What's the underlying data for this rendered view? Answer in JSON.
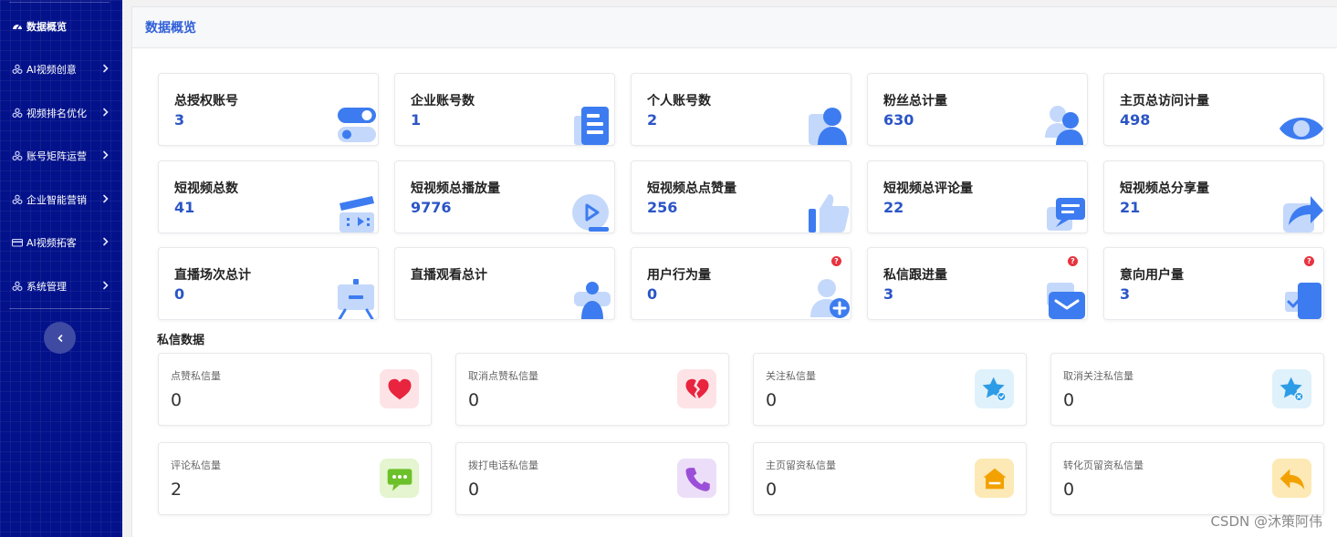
{
  "sidebar": {
    "items": [
      {
        "label": "数据概览",
        "icon": "dashboard-icon",
        "active": true,
        "has_arrow": false
      },
      {
        "label": "AI视频创意",
        "icon": "cluster-icon",
        "active": false,
        "has_arrow": true
      },
      {
        "label": "视频排名优化",
        "icon": "cluster-icon",
        "active": false,
        "has_arrow": true
      },
      {
        "label": "账号矩阵运营",
        "icon": "cluster-icon",
        "active": false,
        "has_arrow": true
      },
      {
        "label": "企业智能营销",
        "icon": "cluster-icon",
        "active": false,
        "has_arrow": true
      },
      {
        "label": "AI视频拓客",
        "icon": "card-icon",
        "active": false,
        "has_arrow": true
      },
      {
        "label": "系统管理",
        "icon": "cluster-icon",
        "active": false,
        "has_arrow": true
      }
    ],
    "collapse_icon": "chevron-left-icon"
  },
  "header": {
    "title": "数据概览"
  },
  "stats": [
    {
      "label": "总授权账号",
      "value": "3",
      "icon": "toggle-icon",
      "help": false
    },
    {
      "label": "企业账号数",
      "value": "1",
      "icon": "document-icon",
      "help": false
    },
    {
      "label": "个人账号数",
      "value": "2",
      "icon": "user-icon",
      "help": false
    },
    {
      "label": "粉丝总计量",
      "value": "630",
      "icon": "users-icon",
      "help": false
    },
    {
      "label": "主页总访问计量",
      "value": "498",
      "icon": "eye-icon",
      "help": false
    },
    {
      "label": "短视频总数",
      "value": "41",
      "icon": "clapperboard-icon",
      "help": false
    },
    {
      "label": "短视频总播放量",
      "value": "9776",
      "icon": "play-icon",
      "help": false
    },
    {
      "label": "短视频总点赞量",
      "value": "256",
      "icon": "thumbs-up-icon",
      "help": false
    },
    {
      "label": "短视频总评论量",
      "value": "22",
      "icon": "comment-icon",
      "help": false
    },
    {
      "label": "短视频总分享量",
      "value": "21",
      "icon": "share-icon",
      "help": false
    },
    {
      "label": "直播场次总计",
      "value": "0",
      "icon": "easel-icon",
      "help": false
    },
    {
      "label": "直播观看总计",
      "value": "",
      "icon": "viewer-icon",
      "help": false
    },
    {
      "label": "用户行为量",
      "value": "0",
      "icon": "user-add-icon",
      "help": true
    },
    {
      "label": "私信跟进量",
      "value": "3",
      "icon": "envelope-icon",
      "help": true
    },
    {
      "label": "意向用户量",
      "value": "3",
      "icon": "checklist-icon",
      "help": true
    }
  ],
  "help_glyph": "?",
  "messages": {
    "title": "私信数据",
    "items": [
      {
        "label": "点赞私信量",
        "value": "0",
        "icon": "heart-icon",
        "tile_bg": "#fde3e6"
      },
      {
        "label": "取消点赞私信量",
        "value": "0",
        "icon": "broken-heart-icon",
        "tile_bg": "#fde3e6"
      },
      {
        "label": "关注私信量",
        "value": "0",
        "icon": "star-check-icon",
        "tile_bg": "#dff1fb"
      },
      {
        "label": "取消关注私信量",
        "value": "0",
        "icon": "star-remove-icon",
        "tile_bg": "#dff1fb"
      },
      {
        "label": "评论私信量",
        "value": "2",
        "icon": "chat-icon",
        "tile_bg": "#e4f5cf"
      },
      {
        "label": "拨打电话私信量",
        "value": "0",
        "icon": "phone-icon",
        "tile_bg": "#ecdef8"
      },
      {
        "label": "主页留资私信量",
        "value": "0",
        "icon": "home-icon",
        "tile_bg": "#fde9b5"
      },
      {
        "label": "转化页留资私信量",
        "value": "0",
        "icon": "reply-icon",
        "tile_bg": "#fde9b5"
      }
    ]
  },
  "watermark": "CSDN @沐策阿伟",
  "colors": {
    "sidebar_bg": "#03128a",
    "accent": "#2f5fd8",
    "value": "#2b55c6",
    "icon_blue": "#3d7cf0",
    "icon_light": "#c4d8fb"
  }
}
